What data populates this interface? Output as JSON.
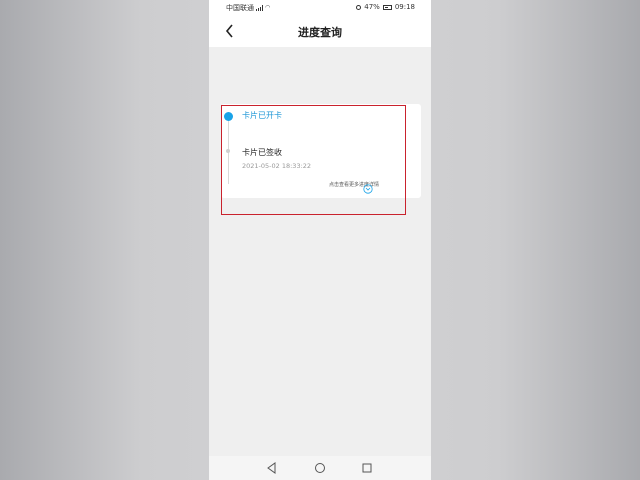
{
  "status_bar": {
    "carrier": "中国联通",
    "battery": "47%",
    "time": "09:18"
  },
  "nav": {
    "title": "进度查询"
  },
  "progress": {
    "steps": [
      {
        "label": "卡片已开卡",
        "time": ""
      },
      {
        "label": "卡片已签收",
        "time": "2021-05-02 18:33:22"
      }
    ],
    "more_link": "点击查看更多进度详情"
  },
  "colors": {
    "active": "#1aa3e8",
    "highlight": "#c9222d"
  },
  "icons": {
    "back": "chevron-left-icon",
    "expand": "circle-chevron-down-icon",
    "nav_back": "triangle-back-icon",
    "nav_home": "circle-home-icon",
    "nav_recent": "square-recent-icon"
  }
}
